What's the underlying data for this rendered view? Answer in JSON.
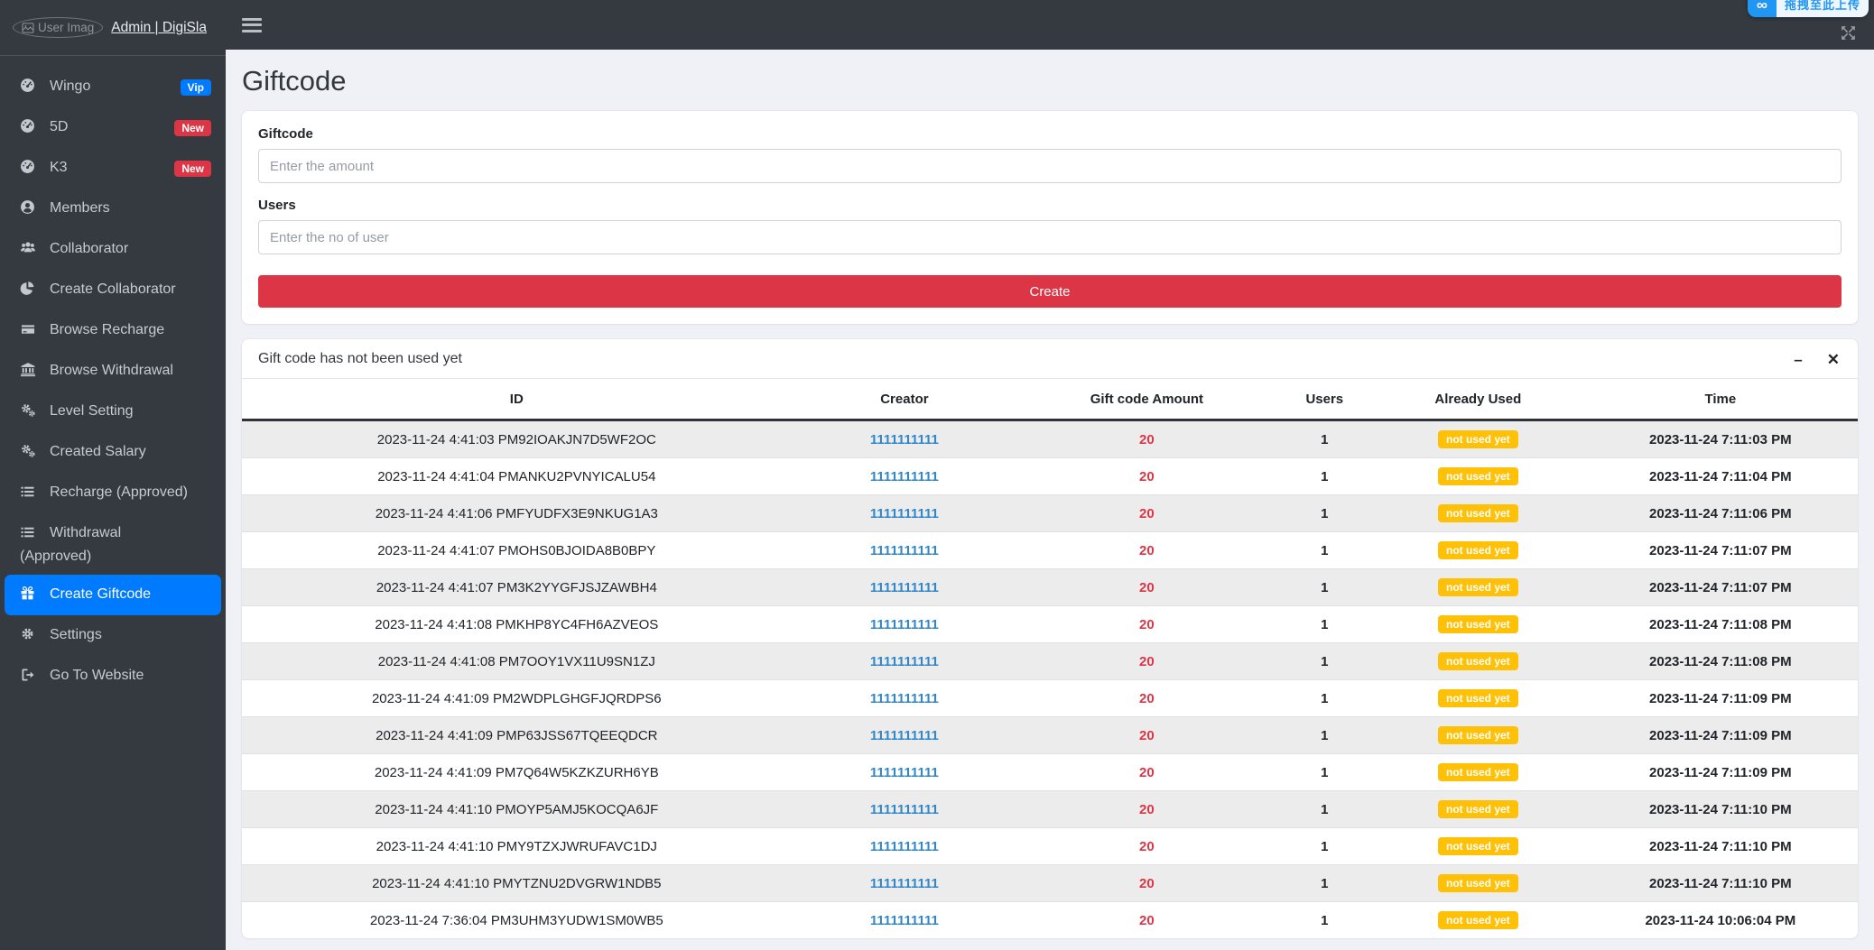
{
  "topbar": {
    "upload_overlay": {
      "icon": "infinity",
      "text": "拖拽至此上传"
    }
  },
  "sidebar": {
    "user": {
      "avatar_alt": "User Imag",
      "admin_link": "Admin | DigiSla"
    },
    "items": [
      {
        "label": "Wingo",
        "icon": "tachometer",
        "badge": "Vip",
        "badge_color": "#007bff"
      },
      {
        "label": "5D",
        "icon": "tachometer",
        "badge": "New",
        "badge_color": "#dc3545"
      },
      {
        "label": "K3",
        "icon": "tachometer",
        "badge": "New",
        "badge_color": "#dc3545"
      },
      {
        "label": "Members",
        "icon": "user"
      },
      {
        "label": "Collaborator",
        "icon": "users"
      },
      {
        "label": "Create Collaborator",
        "icon": "pie-chart"
      },
      {
        "label": "Browse Recharge",
        "icon": "credit-card"
      },
      {
        "label": "Browse Withdrawal",
        "icon": "bank"
      },
      {
        "label": "Level Setting",
        "icon": "cogs"
      },
      {
        "label": "Created Salary",
        "icon": "cogs"
      },
      {
        "label": "Recharge (Approved)",
        "icon": "list"
      },
      {
        "label": "Withdrawal (Approved)",
        "icon": "list"
      },
      {
        "label": "Create Giftcode",
        "icon": "gift",
        "active": true
      },
      {
        "label": "Settings",
        "icon": "gear"
      },
      {
        "label": "Go To Website",
        "icon": "sign-out"
      }
    ]
  },
  "page": {
    "title": "Giftcode"
  },
  "form": {
    "giftcode_label": "Giftcode",
    "giftcode_placeholder": "Enter the amount",
    "users_label": "Users",
    "users_placeholder": "Enter the no of user",
    "submit_label": "Create"
  },
  "table_card": {
    "title": "Gift code has not been used yet",
    "columns": [
      "ID",
      "Creator",
      "Gift code Amount",
      "Users",
      "Already Used",
      "Time"
    ],
    "rows": [
      {
        "id": "2023-11-24 4:41:03 PM92IOAKJN7D5WF2OC",
        "creator": "1111111111",
        "amount": "20",
        "users": "1",
        "used": "not used yet",
        "time": "2023-11-24 7:11:03 PM"
      },
      {
        "id": "2023-11-24 4:41:04 PMANKU2PVNYICALU54",
        "creator": "1111111111",
        "amount": "20",
        "users": "1",
        "used": "not used yet",
        "time": "2023-11-24 7:11:04 PM"
      },
      {
        "id": "2023-11-24 4:41:06 PMFYUDFX3E9NKUG1A3",
        "creator": "1111111111",
        "amount": "20",
        "users": "1",
        "used": "not used yet",
        "time": "2023-11-24 7:11:06 PM"
      },
      {
        "id": "2023-11-24 4:41:07 PMOHS0BJOIDA8B0BPY",
        "creator": "1111111111",
        "amount": "20",
        "users": "1",
        "used": "not used yet",
        "time": "2023-11-24 7:11:07 PM"
      },
      {
        "id": "2023-11-24 4:41:07 PM3K2YYGFJSJZAWBH4",
        "creator": "1111111111",
        "amount": "20",
        "users": "1",
        "used": "not used yet",
        "time": "2023-11-24 7:11:07 PM"
      },
      {
        "id": "2023-11-24 4:41:08 PMKHP8YC4FH6AZVEOS",
        "creator": "1111111111",
        "amount": "20",
        "users": "1",
        "used": "not used yet",
        "time": "2023-11-24 7:11:08 PM"
      },
      {
        "id": "2023-11-24 4:41:08 PM7OOY1VX11U9SN1ZJ",
        "creator": "1111111111",
        "amount": "20",
        "users": "1",
        "used": "not used yet",
        "time": "2023-11-24 7:11:08 PM"
      },
      {
        "id": "2023-11-24 4:41:09 PM2WDPLGHGFJQRDPS6",
        "creator": "1111111111",
        "amount": "20",
        "users": "1",
        "used": "not used yet",
        "time": "2023-11-24 7:11:09 PM"
      },
      {
        "id": "2023-11-24 4:41:09 PMP63JSS67TQEEQDCR",
        "creator": "1111111111",
        "amount": "20",
        "users": "1",
        "used": "not used yet",
        "time": "2023-11-24 7:11:09 PM"
      },
      {
        "id": "2023-11-24 4:41:09 PM7Q64W5KZKZURH6YB",
        "creator": "1111111111",
        "amount": "20",
        "users": "1",
        "used": "not used yet",
        "time": "2023-11-24 7:11:09 PM"
      },
      {
        "id": "2023-11-24 4:41:10 PMOYP5AMJ5KOCQA6JF",
        "creator": "1111111111",
        "amount": "20",
        "users": "1",
        "used": "not used yet",
        "time": "2023-11-24 7:11:10 PM"
      },
      {
        "id": "2023-11-24 4:41:10 PMY9TZXJWRUFAVC1DJ",
        "creator": "1111111111",
        "amount": "20",
        "users": "1",
        "used": "not used yet",
        "time": "2023-11-24 7:11:10 PM"
      },
      {
        "id": "2023-11-24 4:41:10 PMYTZNU2DVGRW1NDB5",
        "creator": "1111111111",
        "amount": "20",
        "users": "1",
        "used": "not used yet",
        "time": "2023-11-24 7:11:10 PM"
      },
      {
        "id": "2023-11-24 7:36:04 PM3UHM3YUDW1SM0WB5",
        "creator": "1111111111",
        "amount": "20",
        "users": "1",
        "used": "not used yet",
        "time": "2023-11-24 10:06:04 PM"
      }
    ]
  },
  "colors": {
    "sidebar_bg": "#343a40",
    "active_item": "#007bff",
    "danger": "#dc3545",
    "badge_yellow": "#ffc107",
    "link_blue": "#3187c9"
  }
}
